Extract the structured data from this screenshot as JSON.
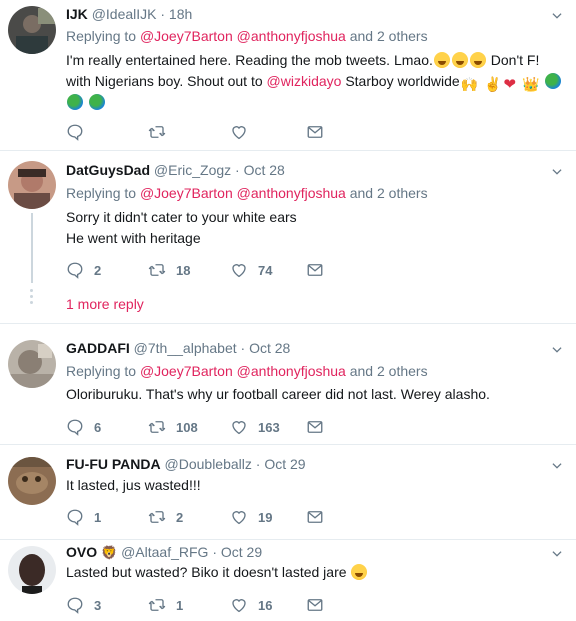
{
  "tweets": [
    {
      "name": "IJK",
      "handle": "@IdealIJK · 18h",
      "replying_prefix": "Replying to ",
      "mention1": "@Joey7Barton",
      "mention2": "@anthonyfjoshua",
      "replying_suffix": " and 2 others",
      "text_line1": "I'm really entertained here. Reading the mob tweets. Lmao.",
      "text_line1_end": " Don't F!",
      "text_line2_a": "with Nigerians boy. Shout out to ",
      "text_line2_mention": "@wizkidayo",
      "text_line2_b": " Starboy worldwide",
      "emoji_laugh": "😂",
      "emoji_globe": "🌎",
      "emoji_hands": "🙌",
      "emoji_victory": "✌",
      "emoji_heart": "❤",
      "emoji_crown": "👑"
    },
    {
      "name": "DatGuysDad",
      "handle": "@Eric_Zogz · Oct 28",
      "replying_prefix": "Replying to ",
      "mention1": "@Joey7Barton",
      "mention2": "@anthonyfjoshua",
      "replying_suffix": " and 2 others",
      "text_line1": "Sorry it didn't cater to your white ears",
      "text_line2": "He went with heritage",
      "replies": "2",
      "retweets": "18",
      "likes": "74",
      "more_reply": "1 more reply"
    },
    {
      "name": "GADDAFI",
      "handle": "@7th__alphabet · Oct 28",
      "replying_prefix": "Replying to ",
      "mention1": "@Joey7Barton",
      "mention2": "@anthonyfjoshua",
      "replying_suffix": " and 2 others",
      "text_line1": "Oloriburuku. That's why ur football career did not last. Werey alasho.",
      "replies": "6",
      "retweets": "108",
      "likes": "163"
    },
    {
      "name": "FU-FU PANDA",
      "handle": "@Doubleballz · Oct 29",
      "text_line1": "It lasted, jus wasted!!!",
      "replies": "1",
      "retweets": "2",
      "likes": "19"
    },
    {
      "name": "OVO",
      "name_emoji": "🦁",
      "handle": "@Altaaf_RFG · Oct 29",
      "text_line1": "Lasted but wasted? Biko it doesn't lasted jare",
      "replies": "3",
      "retweets": "1",
      "likes": "16"
    }
  ],
  "colors": {
    "mention": "#e0245e",
    "muted": "#657786",
    "text": "#14171a",
    "divider": "#e6ecf0"
  }
}
